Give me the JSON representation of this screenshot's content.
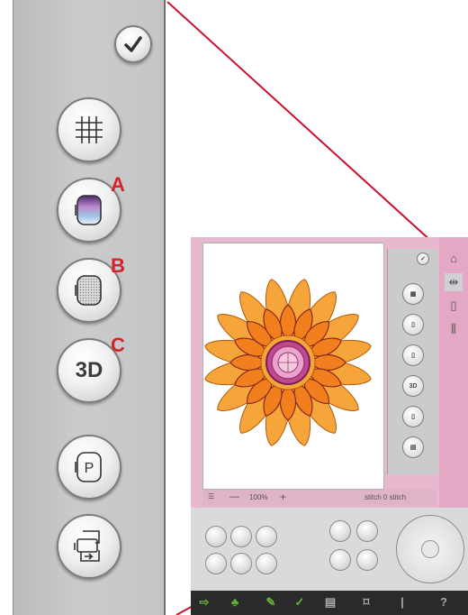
{
  "zoom_panel": {
    "buttons": [
      {
        "name": "confirm-button",
        "icon": "check-icon"
      },
      {
        "name": "grid-button",
        "icon": "grid-icon"
      },
      {
        "name": "hoop-a-button",
        "icon": "hoop-colored-icon",
        "callout": "A"
      },
      {
        "name": "hoop-b-button",
        "icon": "hoop-hatched-icon",
        "callout": "B"
      },
      {
        "name": "3d-button",
        "label": "3D",
        "callout": "C"
      },
      {
        "name": "hoop-p-button",
        "icon": "hoop-p-icon",
        "label": "P"
      },
      {
        "name": "hoop-multi-button",
        "icon": "multi-hoop-icon"
      }
    ]
  },
  "screen": {
    "mini_panel": {
      "label_3d": "3D"
    },
    "status_bar": {
      "zoom_minus": "—",
      "zoom_value": "100%",
      "zoom_plus": "+",
      "info_text": "stitch 0 stitch"
    }
  },
  "colors": {
    "callout": "#d4232a",
    "leader_line": "#c8102e",
    "screen_pink": "#e8b8cf",
    "bottom_bar": "#2a2a2a",
    "bottom_bar_icons": "#63b33a"
  }
}
